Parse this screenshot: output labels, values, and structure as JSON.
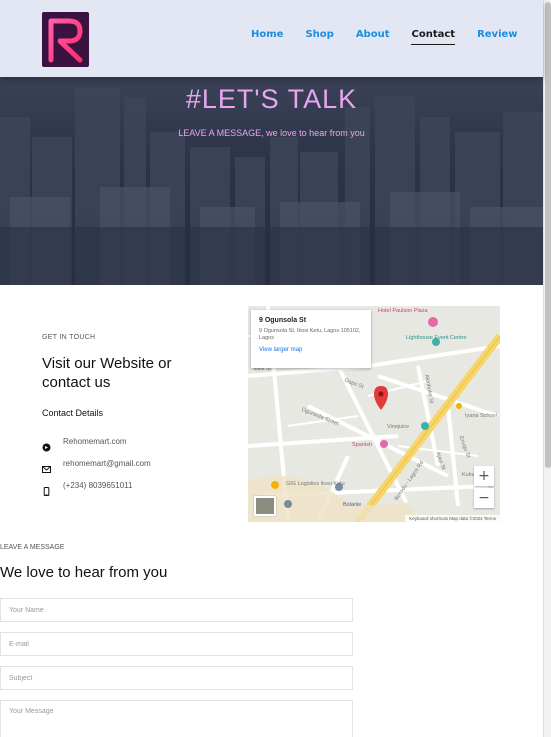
{
  "header": {
    "nav": [
      "Home",
      "Shop",
      "About",
      "Contact",
      "Review"
    ],
    "active_nav": "Contact"
  },
  "hero": {
    "title": "#LET'S TALK",
    "subtitle": "LEAVE A MESSAGE, we love to hear from you"
  },
  "contact": {
    "eyebrow": "GET IN TOUCH",
    "heading": "Visit our Website or contact us",
    "details_label": "Contact Details",
    "items": [
      {
        "icon": "globe-icon",
        "text": "Rehomemart.com"
      },
      {
        "icon": "envelope-icon",
        "text": "rehomemart@gmail.com"
      },
      {
        "icon": "phone-icon",
        "text": "(+234) 8039651011"
      }
    ]
  },
  "map": {
    "place_title": "9 Ogunsola St",
    "place_address": "9 Ogunsola St, Ikosi Ketu, Lagos 105102, Lagos",
    "view_larger": "View larger map",
    "labels": [
      "Hotel Paulson Plaza",
      "Lighthouse Event Centre",
      "Iyana School",
      "Ekiti St",
      "Ogunsola Street",
      "Dapo St",
      "Vinejuice",
      "Spanish",
      "GIG Logistics Ikosi Ketu",
      "Bolanle",
      "Ikorodu - Lagos Rd",
      "Kuku",
      "Enugu St",
      "Ajayi St",
      "Akinhoke St"
    ],
    "footer": "Keyboard shortcuts   Map data ©2024   Terms",
    "zoom_in": "+",
    "zoom_out": "−"
  },
  "form": {
    "eyebrow": "LEAVE A MESSAGE",
    "heading": "We love to hear from you",
    "placeholders": {
      "name": "Your Name",
      "email": "E-mail",
      "subject": "Subject",
      "message": "Your Message"
    }
  },
  "colors": {
    "accent_pink": "#e8a6f0",
    "link_blue": "#1a8ee0",
    "header_bg": "#e3e6f3",
    "hero_bg": "#2d3448",
    "logo_bg": "#3a1340"
  }
}
